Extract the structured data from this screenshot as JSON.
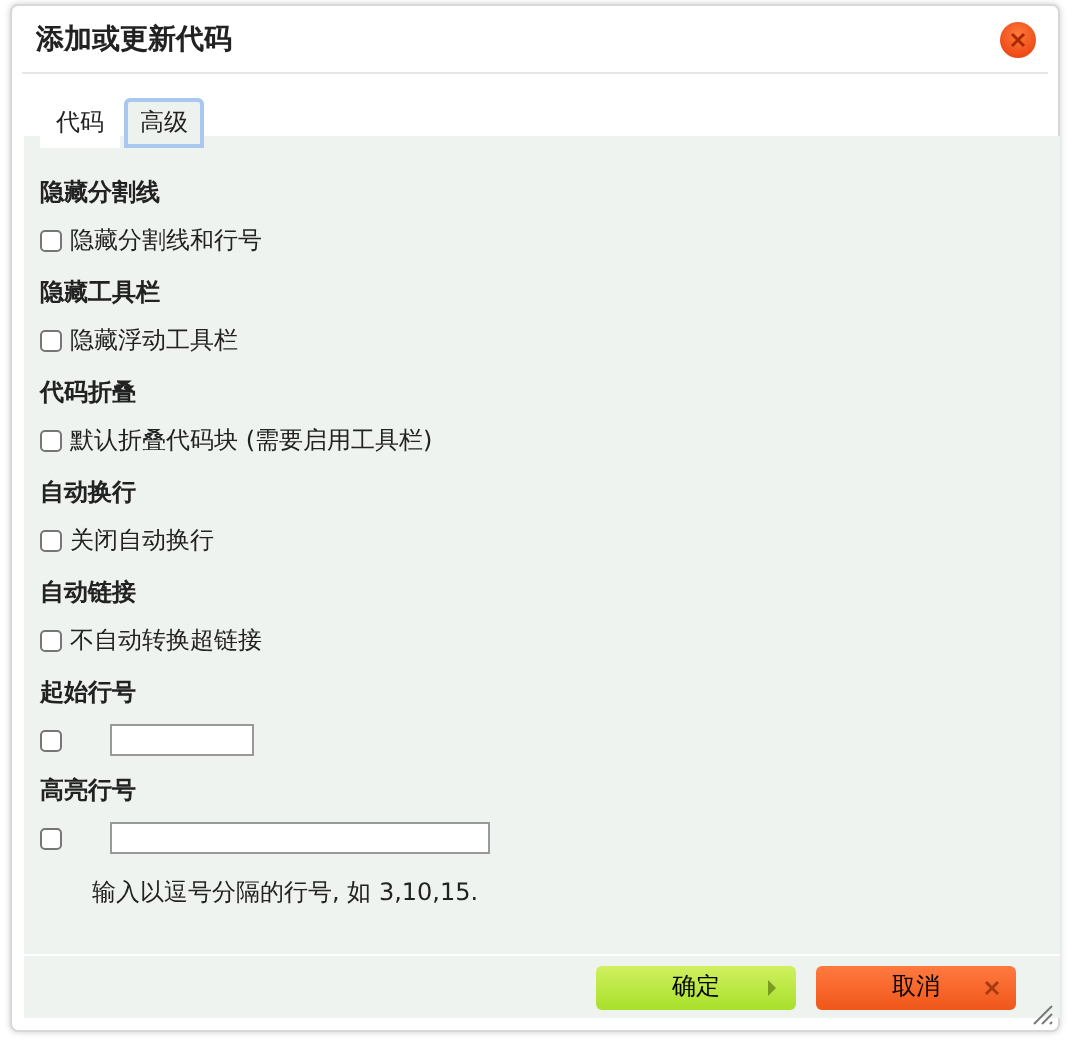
{
  "dialog": {
    "title": "添加或更新代码"
  },
  "tabs": [
    {
      "label": "代码",
      "selected": false
    },
    {
      "label": "高级",
      "selected": true
    }
  ],
  "sections": [
    {
      "heading": "隐藏分割线",
      "kind": "checkbox",
      "label": "隐藏分割线和行号",
      "checked": false
    },
    {
      "heading": "隐藏工具栏",
      "kind": "checkbox",
      "label": "隐藏浮动工具栏",
      "checked": false
    },
    {
      "heading": "代码折叠",
      "kind": "checkbox",
      "label": "默认折叠代码块 (需要启用工具栏)",
      "checked": false
    },
    {
      "heading": "自动换行",
      "kind": "checkbox",
      "label": "关闭自动换行",
      "checked": false
    },
    {
      "heading": "自动链接",
      "kind": "checkbox",
      "label": "不自动转换超链接",
      "checked": false
    },
    {
      "heading": "起始行号",
      "kind": "short-input",
      "checked": false
    },
    {
      "heading": "高亮行号",
      "kind": "long-input",
      "checked": false,
      "hint": "输入以逗号分隔的行号, 如 3,10,15."
    }
  ],
  "buttons": [
    {
      "label": "确定",
      "kind": "ok"
    },
    {
      "label": "取消",
      "kind": "cancel"
    }
  ]
}
